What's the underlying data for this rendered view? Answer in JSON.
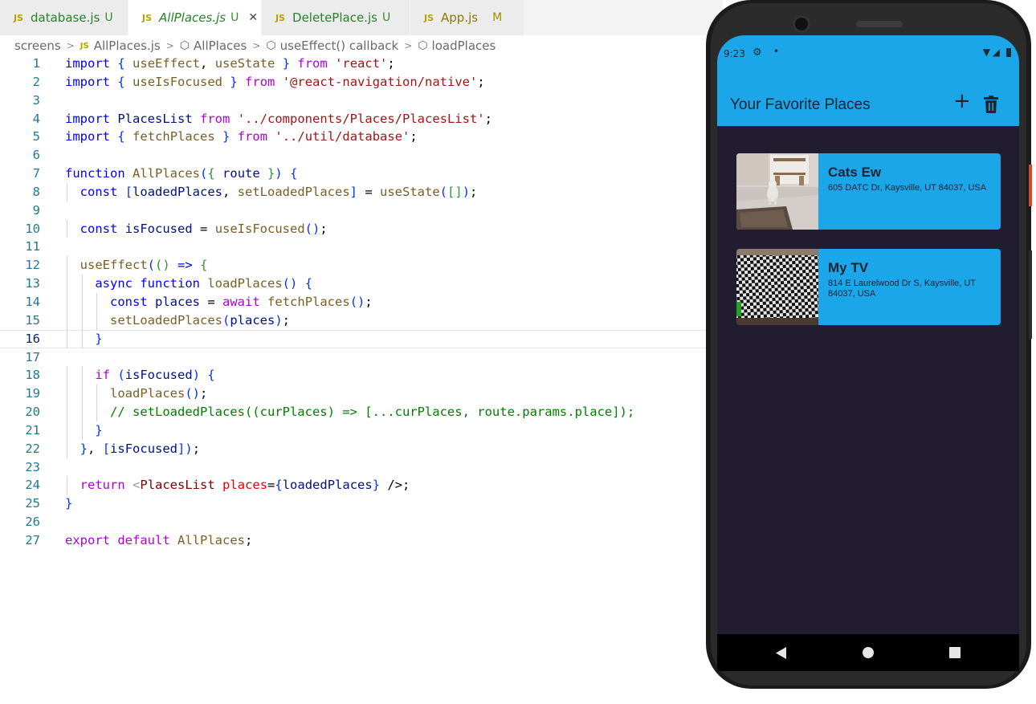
{
  "editor": {
    "tabs": [
      {
        "badge": "JS",
        "name": "database.js",
        "status": "U"
      },
      {
        "badge": "JS",
        "name": "AllPlaces.js",
        "status": "U",
        "close": "✕"
      },
      {
        "badge": "JS",
        "name": "DeletePlace.js",
        "status": "U"
      },
      {
        "badge": "JS",
        "name": "App.js",
        "status": "M"
      }
    ],
    "breadcrumb": {
      "folder": "screens",
      "file_badge": "JS",
      "file": "AllPlaces.js",
      "symbol1": "AllPlaces",
      "symbol2": "useEffect() callback",
      "symbol3": "loadPlaces"
    },
    "current_line": 16,
    "lines": [
      "import { useEffect, useState } from 'react';",
      "import { useIsFocused } from '@react-navigation/native';",
      "",
      "import PlacesList from '../components/Places/PlacesList';",
      "import { fetchPlaces } from '../util/database';",
      "",
      "function AllPlaces({ route }) {",
      "  const [loadedPlaces, setLoadedPlaces] = useState([]);",
      "",
      "  const isFocused = useIsFocused();",
      "",
      "  useEffect(() => {",
      "    async function loadPlaces() {",
      "      const places = await fetchPlaces();",
      "      setLoadedPlaces(places);",
      "    }",
      "",
      "    if (isFocused) {",
      "      loadPlaces();",
      "      // setLoadedPlaces((curPlaces) => [...curPlaces, route.params.place]);",
      "    }",
      "  }, [isFocused]);",
      "",
      "  return <PlacesList places={loadedPlaces} />;",
      "}",
      "",
      "export default AllPlaces;"
    ]
  },
  "phone": {
    "status": {
      "time": "9:23",
      "gear_icon": "gear-icon",
      "dot": "•"
    },
    "app_title": "Your Favorite Places",
    "add_label": "+",
    "places": [
      {
        "title": "Cats Ew",
        "address": "605 DATC Dr, Kaysville, UT 84037, USA"
      },
      {
        "title": "My TV",
        "address": "814 E Laurelwood Dr S, Kaysville, UT 84037, USA"
      }
    ],
    "colors": {
      "primary": "#1aa6e8",
      "background": "#221c30"
    }
  }
}
